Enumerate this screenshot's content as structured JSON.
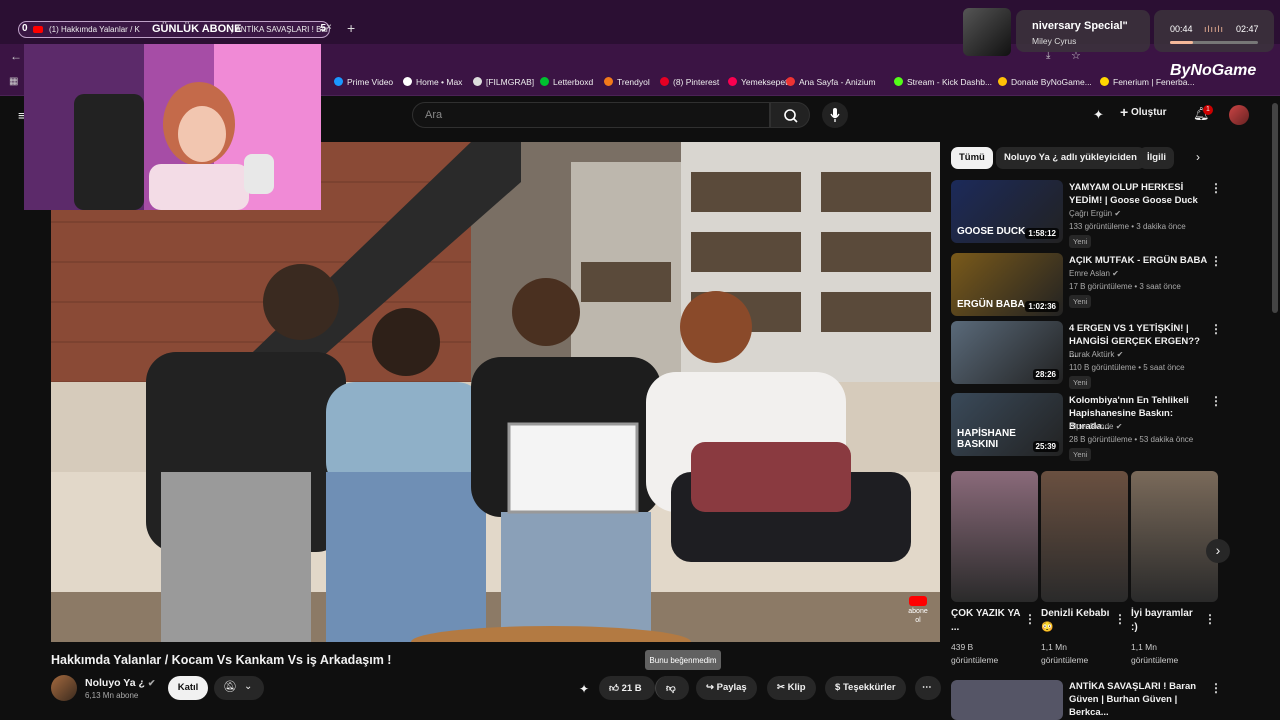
{
  "browser": {
    "tab_number": "0",
    "tab_title": "(1) Hakkımda Yalanlar / K",
    "overlay_text": "GÜNLÜK ABONE",
    "tab_title_tail": ") ANTİKA SAVAŞLARI ! Baran",
    "tab_number_right": "5",
    "close": "×",
    "new_tab": "+",
    "bookmarks": [
      {
        "label": "Prime Video",
        "color": "#1a98ff"
      },
      {
        "label": "Home • Max",
        "color": "#ffffff"
      },
      {
        "label": "[FILMGRAB]",
        "color": "#dddddd"
      },
      {
        "label": "Letterboxd",
        "color": "#00c030"
      },
      {
        "label": "Trendyol",
        "color": "#f27a1a"
      },
      {
        "label": "(8) Pinterest",
        "color": "#e60023"
      },
      {
        "label": "Yemeksepeti",
        "color": "#fa0050"
      },
      {
        "label": "Ana Sayfa - Anizium",
        "color": "#e33"
      },
      {
        "label": "Stream - Kick Dashb...",
        "color": "#53fc18"
      },
      {
        "label": "Donate ByNoGame...",
        "color": "#ffc107"
      },
      {
        "label": "Fenerium | Fenerba...",
        "color": "#ffd700"
      }
    ]
  },
  "overlay": {
    "song_title": "niversary Special\"",
    "artist": "Miley Cyrus",
    "time_elapsed": "00:44",
    "time_total": "02:47",
    "brand": "ByNoGame"
  },
  "header": {
    "search_placeholder": "Ara",
    "create_label": "Oluştur",
    "notifications_count": "1"
  },
  "video": {
    "title": "Hakkımda Yalanlar / Kocam Vs Kankam Vs iş Arkadaşım !",
    "channel_name": "Noluyo Ya ¿",
    "subscribers": "6,13 Mn abone",
    "join_label": "Katıl",
    "likes": "21 B",
    "share_label": "Paylaş",
    "clip_label": "Klip",
    "thanks_label": "Teşekkürler",
    "dislike_tooltip": "Bunu beğenmedim",
    "watermark": "abone ol"
  },
  "sidebar": {
    "chips": [
      "Tümü",
      "Noluyo Ya ¿ adlı yükleyiciden",
      "İlgili"
    ],
    "recommendations": [
      {
        "title": "YAMYAM OLUP HERKESİ YEDİM! | Goose Goose Duck",
        "channel": "Çağrı Ergün",
        "meta": "133 görüntüleme • 3 dakika önce",
        "badge": "Yeni",
        "duration": "1:58:12",
        "thumb_color": "#1c2a5a",
        "thumb_text": "GOOSE DUCK"
      },
      {
        "title": "AÇIK MUTFAK - ERGÜN BABA",
        "channel": "Emre Aslan",
        "meta": "17 B görüntüleme • 3 saat önce",
        "badge": "Yeni",
        "duration": "1:02:36",
        "thumb_color": "#7a5a1a",
        "thumb_text": "ERGÜN BABA"
      },
      {
        "title": "4 ERGEN VS 1 YETİŞKİN! | HANGİSİ GERÇEK ERGEN?? ...",
        "channel": "Burak Aktürk",
        "meta": "110 B görüntüleme • 5 saat önce",
        "badge": "Yeni",
        "duration": "28:26",
        "thumb_color": "#5a6a7a",
        "thumb_text": ""
      },
      {
        "title": "Kolombiya'nın En Tehlikeli Hapishanesine Baskın: Burada...",
        "channel": "Alper Rende",
        "meta": "28 B görüntüleme • 53 dakika önce",
        "badge": "Yeni",
        "duration": "25:39",
        "thumb_color": "#3a4a5a",
        "thumb_text": "HAPİSHANE BASKINI"
      }
    ],
    "shorts": [
      {
        "title": "ÇOK YAZIK YA ...",
        "views": "439 B görüntüleme",
        "thumb_color": "#8a6a7a"
      },
      {
        "title": "Denizli Kebabı 😳",
        "views": "1,1 Mn görüntüleme",
        "thumb_color": "#6a5040"
      },
      {
        "title": "İyi bayramlar :)",
        "views": "1,1 Mn görüntüleme",
        "thumb_color": "#7a6a5a"
      }
    ],
    "last_recommendation": "ANTİKA SAVAŞLARI ! Baran Güven | Burhan Güven | Berkca..."
  }
}
